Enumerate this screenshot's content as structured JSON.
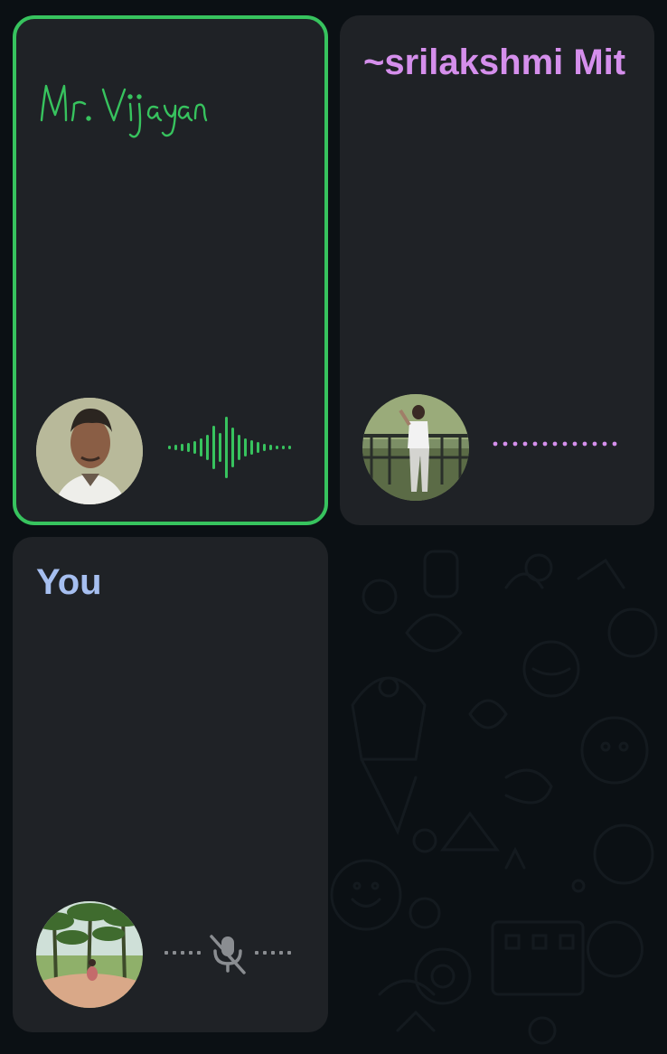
{
  "participants": [
    {
      "name": "Mr. Vijayan",
      "avatar": "person-photo",
      "status": "speaking",
      "accent": "#37c35e"
    },
    {
      "name": "~srilakshmi Mit",
      "avatar": "person-photo",
      "status": "silent",
      "accent": "#d58fec"
    },
    {
      "name": "You",
      "avatar": "landscape-photo",
      "status": "muted",
      "accent": "#a6bff0"
    }
  ],
  "icons": {
    "muted": "mic-off-icon",
    "speaking": "sound-wave-icon",
    "idle": "dotted-line-icon"
  }
}
